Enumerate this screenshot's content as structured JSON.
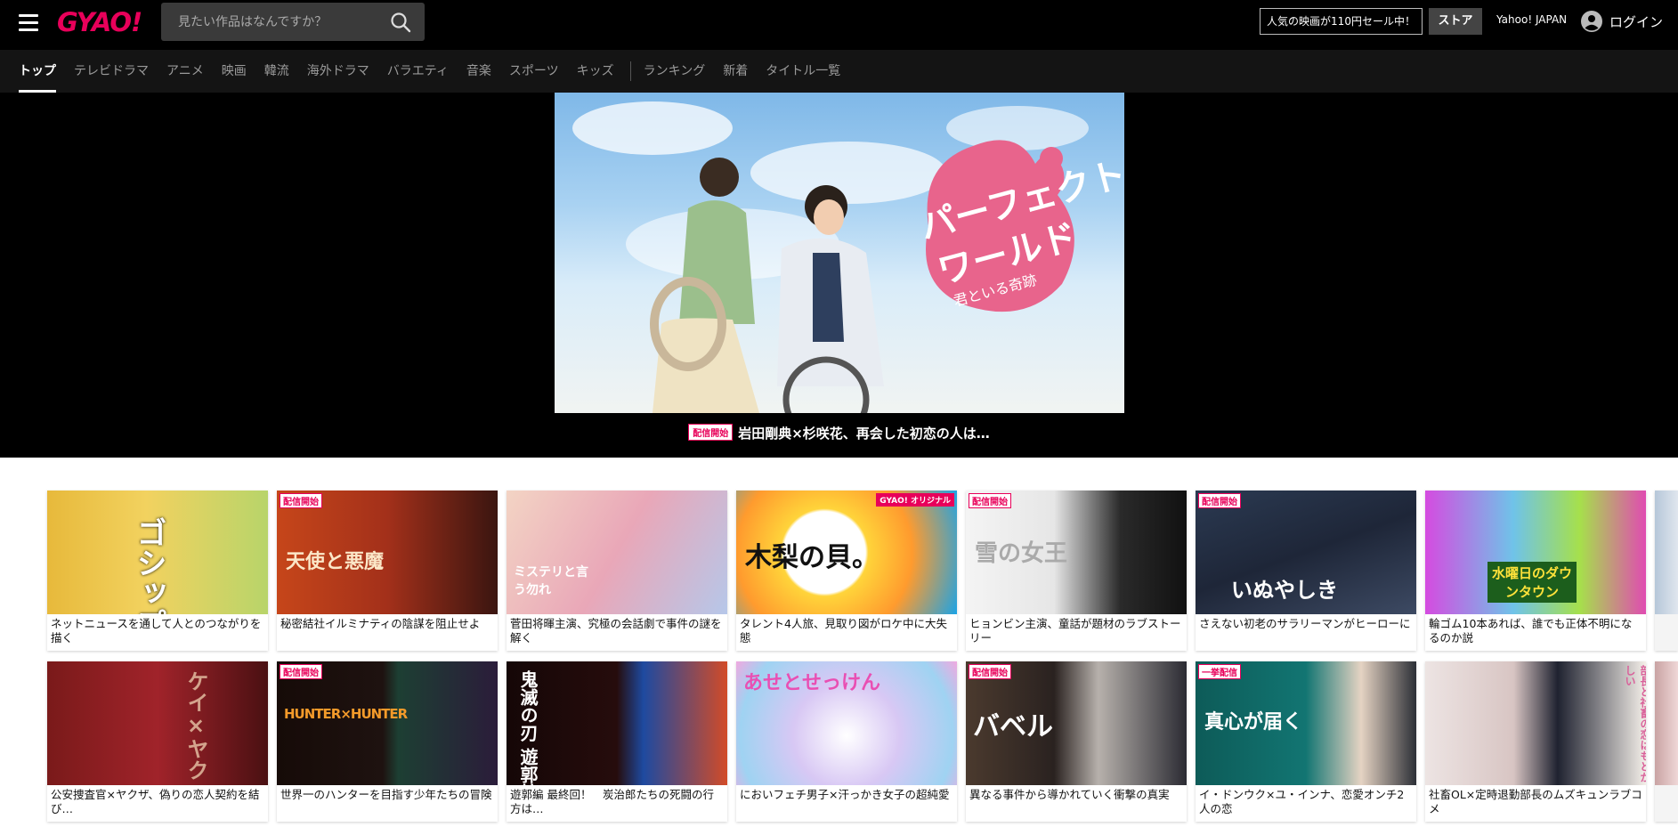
{
  "header": {
    "logo": "GYAO!",
    "search_placeholder": "見たい作品はなんですか？",
    "sale_link": "人気の映画が110円セール中！",
    "store_button": "ストア",
    "yahoo_link": "Yahoo! JAPAN",
    "login": "ログイン"
  },
  "nav": {
    "items": [
      "トップ",
      "テレビドラマ",
      "アニメ",
      "映画",
      "韓流",
      "海外ドラマ",
      "バラエティ",
      "音楽",
      "スポーツ",
      "キッズ"
    ],
    "items2": [
      "ランキング",
      "新着",
      "タイトル一覧"
    ],
    "active": "トップ"
  },
  "hero": {
    "badge": "配信開始",
    "caption": "岩田剛典×杉咲花、再会した初恋の人は…",
    "art_title_1": "パーフェクト",
    "art_title_2": "ワールド",
    "art_subtitle": "君といる奇跡"
  },
  "cards_row1": [
    {
      "title": "ネットニュースを通して人とのつながりを描く",
      "badge": "",
      "art": "ゴシップ"
    },
    {
      "title": "秘密結社イルミナティの陰謀を阻止せよ",
      "badge": "配信開始",
      "art": "天使と悪魔"
    },
    {
      "title": "菅田将暉主演、究極の会話劇で事件の謎を解く",
      "badge": "",
      "art": "ミステリと言う勿れ"
    },
    {
      "title": "タレント4人旅、見取り図がロケ中に大失態",
      "badge": "GYAO! オリジナル",
      "art": "木梨の貝。"
    },
    {
      "title": "ヒョンビン主演、童話が題材のラブストーリー",
      "badge": "配信開始",
      "art": "雪の女王"
    },
    {
      "title": "さえない初老のサラリーマンがヒーローに",
      "badge": "配信開始",
      "art": "いぬやしき"
    },
    {
      "title": "輪ゴム10本あれば、誰でも正体不明になるのか説",
      "badge": "",
      "art": "水曜日のダウンタウン"
    }
  ],
  "cards_row2": [
    {
      "title": "公安捜査官×ヤクザ、偽りの恋人契約を結び…",
      "badge": "",
      "art": "ケイ×ヤク"
    },
    {
      "title": "世界一のハンターを目指す少年たちの冒険",
      "badge": "配信開始",
      "art": "HUNTER×HUNTER"
    },
    {
      "title": "遊郭編 最終回！　炭治郎たちの死闘の行方は…",
      "badge": "",
      "art": "鬼滅の刃 遊郭編"
    },
    {
      "title": "においフェチ男子×汗っかき女子の超純愛",
      "badge": "",
      "art": "あせとせっけん"
    },
    {
      "title": "異なる事件から導かれていく衝撃の真実",
      "badge": "配信開始",
      "art": "バベル"
    },
    {
      "title": "イ・ドンウク×ユ・インナ、恋愛オンチ2人の恋",
      "badge": "一挙配信",
      "art": "真心が届く"
    },
    {
      "title": "社畜OL×定時退勤部長のムズキュンラブコメ",
      "badge": "",
      "art": "部長と社畜の恋はもどかしい"
    }
  ],
  "colors": {
    "brand": "#e8005a",
    "header_bg": "#000000",
    "nav_bg": "#141414"
  }
}
